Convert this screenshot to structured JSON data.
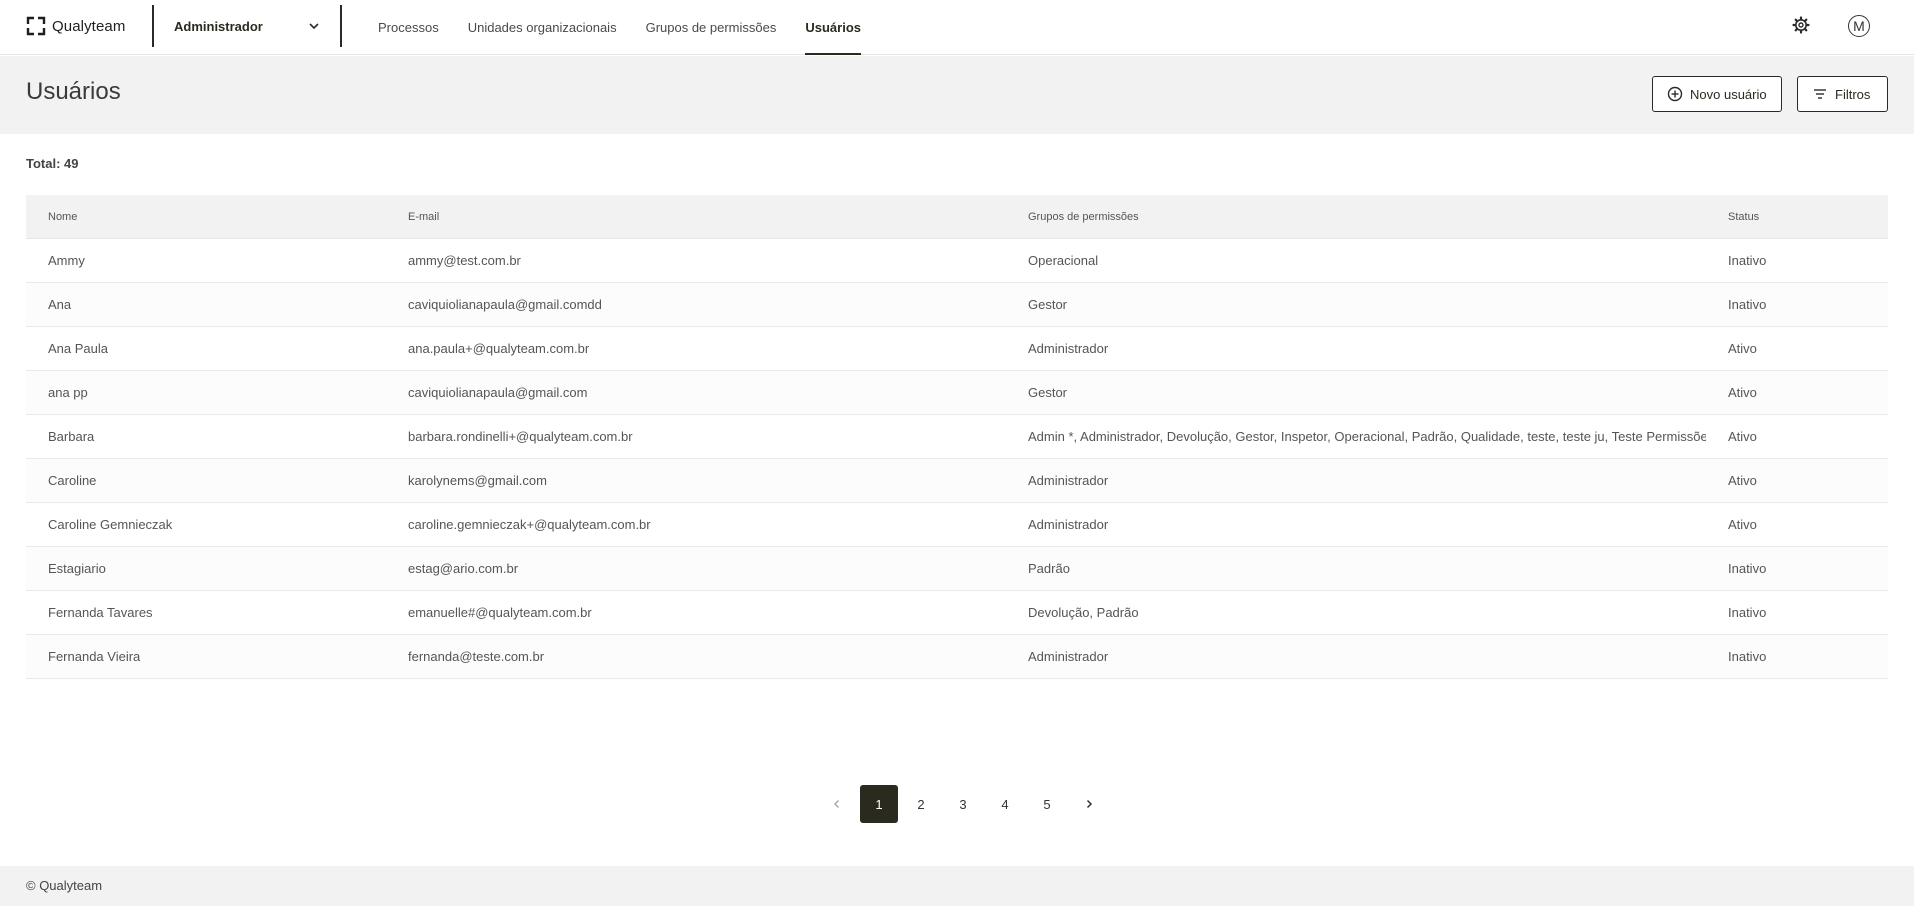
{
  "app": {
    "brand": "Qualyteam"
  },
  "context_select": {
    "value": "Administrador"
  },
  "nav": {
    "items": [
      {
        "label": "Processos"
      },
      {
        "label": "Unidades organizacionais"
      },
      {
        "label": "Grupos de permissões"
      },
      {
        "label": "Usuários",
        "active": true
      }
    ]
  },
  "header": {
    "avatar_initial": "M"
  },
  "page": {
    "title": "Usuários",
    "new_user_label": "Novo usuário",
    "filters_label": "Filtros",
    "total": "Total: 49"
  },
  "table": {
    "columns": [
      "Nome",
      "E-mail",
      "Grupos de permissões",
      "Status"
    ],
    "rows": [
      {
        "name": "Ammy",
        "email": "ammy@test.com.br",
        "groups": "Operacional",
        "status": "Inativo"
      },
      {
        "name": "Ana",
        "email": "caviquiolianapaula@gmail.comdd",
        "groups": "Gestor",
        "status": "Inativo"
      },
      {
        "name": "Ana Paula",
        "email": "ana.paula+@qualyteam.com.br",
        "groups": "Administrador",
        "status": "Ativo"
      },
      {
        "name": "ana pp",
        "email": "caviquiolianapaula@gmail.com",
        "groups": "Gestor",
        "status": "Ativo"
      },
      {
        "name": "Barbara",
        "email": "barbara.rondinelli+@qualyteam.com.br",
        "groups": "Admin *, Administrador, Devolução, Gestor, Inspetor, Operacional, Padrão, Qualidade, teste, teste ju, Teste Permissões",
        "status": "Ativo"
      },
      {
        "name": "Caroline",
        "email": "karolynems@gmail.com",
        "groups": "Administrador",
        "status": "Ativo"
      },
      {
        "name": "Caroline Gemnieczak",
        "email": "caroline.gemnieczak+@qualyteam.com.br",
        "groups": "Administrador",
        "status": "Ativo"
      },
      {
        "name": "Estagiario",
        "email": "estag@ario.com.br",
        "groups": "Padrão",
        "status": "Inativo"
      },
      {
        "name": "Fernanda Tavares",
        "email": "emanuelle#@qualyteam.com.br",
        "groups": "Devolução, Padrão",
        "status": "Inativo"
      },
      {
        "name": "Fernanda Vieira",
        "email": "fernanda@teste.com.br",
        "groups": "Administrador",
        "status": "Inativo"
      }
    ]
  },
  "pagination": {
    "pages": [
      "1",
      "2",
      "3",
      "4",
      "5"
    ],
    "current": "1"
  },
  "footer": {
    "text": "© Qualyteam"
  }
}
